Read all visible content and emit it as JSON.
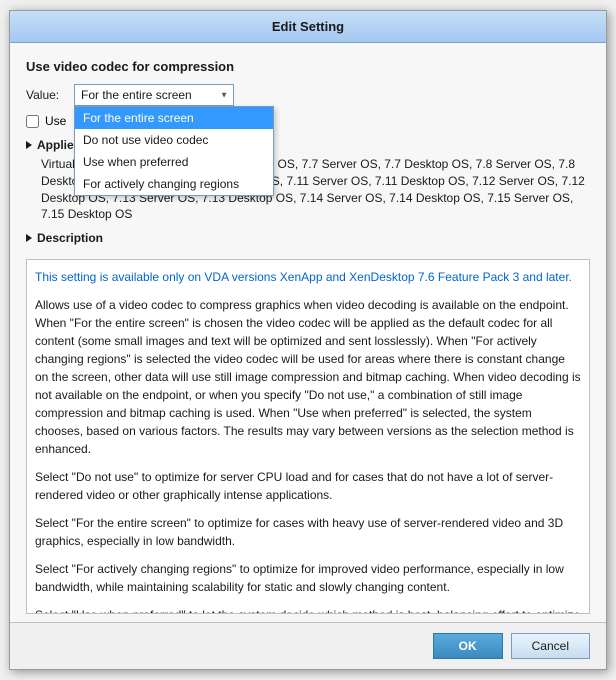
{
  "dialog": {
    "title": "Edit Setting",
    "section_title": "Use video codec for compression",
    "value_label": "Value:",
    "selected_value": "For the entire screen",
    "dropdown_options": [
      {
        "label": "For the entire screen",
        "selected": true
      },
      {
        "label": "Do not use video codec",
        "selected": false
      },
      {
        "label": "Use when preferred",
        "selected": false
      },
      {
        "label": "For actively changing regions",
        "selected": false
      }
    ],
    "checkbox_label": "Use",
    "apply_label": "Applies to",
    "apply_content": "Virtual Delivery Agent, versions 7.6 Desktop OS, 7.7 Server OS, 7.7 Desktop OS, 7.8 Server OS, 7.8 Desktop OS, 7.9 Server OS, 7.9 Desktop OS, 7.11 Server OS, 7.11 Desktop OS, 7.12 Server OS, 7.12 Desktop OS, 7.13 Server OS, 7.13 Desktop OS, 7.14 Server OS, 7.14 Desktop OS, 7.15 Server OS, 7.15 Desktop OS",
    "description_label": "Description",
    "description_intro": "This setting is available only on VDA versions XenApp and XenDesktop 7.6 Feature Pack 3 and later.",
    "description_paragraphs": [
      "Allows use of a video codec to compress graphics when video decoding is available on the endpoint. When \"For the entire screen\" is chosen the video codec will be applied as the default codec for all content (some small images and text will be optimized and sent losslessly). When \"For actively changing regions\" is selected the video codec will be used for areas where there is constant change on the screen, other data will use still image compression and bitmap caching. When video decoding is not available on the endpoint, or when you specify \"Do not use,\" a combination of still image compression and bitmap caching is used. When \"Use when preferred\" is selected, the system chooses, based on various factors. The results may vary between versions as the selection method is enhanced.",
      "Select \"Do not use\" to optimize for server CPU load and for cases that do not have a lot of server-rendered video or other graphically intense applications.",
      "Select \"For the entire screen\" to optimize for cases with heavy use of server-rendered video and 3D graphics, especially in low bandwidth.",
      "Select \"For actively changing regions\" to optimize for improved video performance, especially in low bandwidth, while maintaining scalability for static and slowly changing content.",
      "Select \"Use when preferred\" to let the system decide which method is best, balancing effort to optimize for scalability."
    ],
    "ok_label": "OK",
    "cancel_label": "Cancel"
  }
}
